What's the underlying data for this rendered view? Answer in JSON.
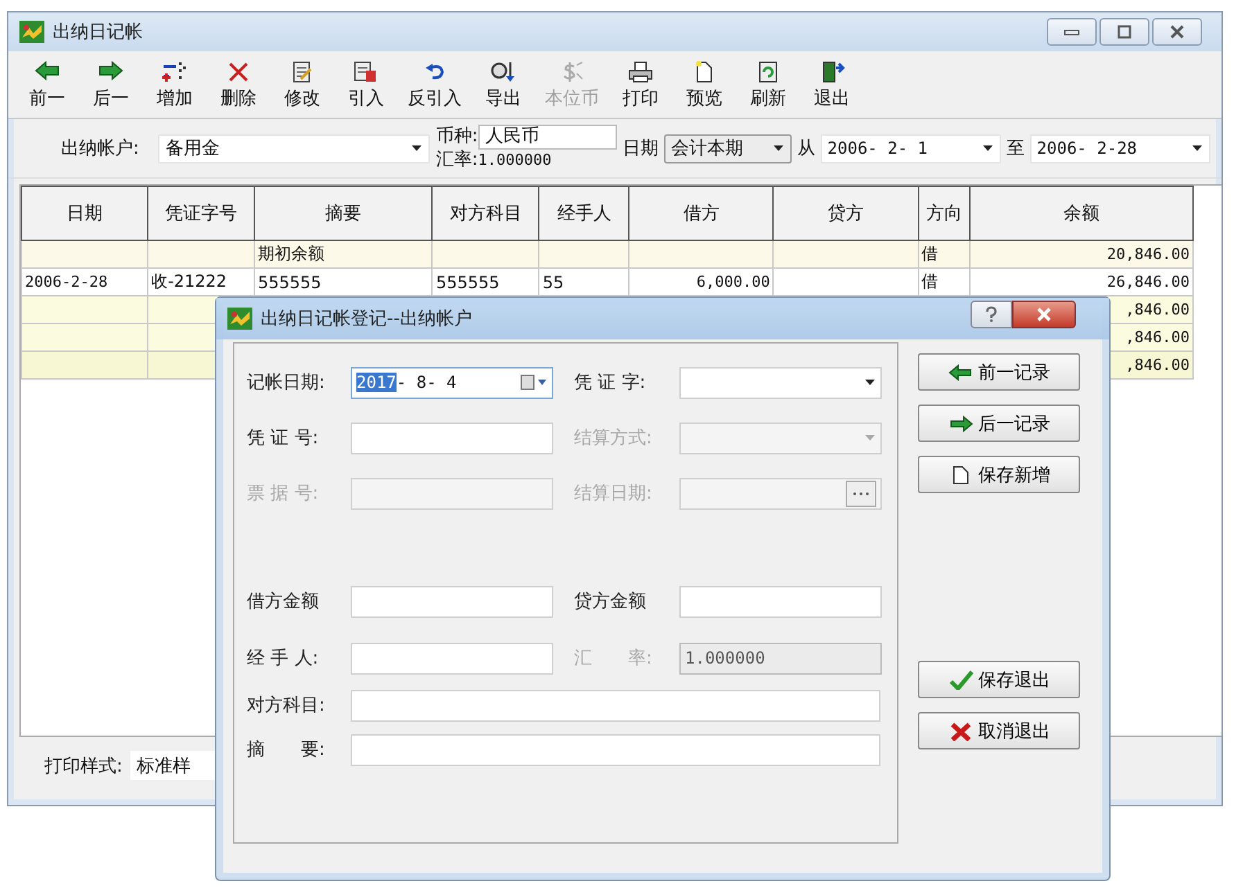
{
  "window": {
    "title": "出纳日记帐"
  },
  "toolbar": [
    {
      "label": "前一",
      "disabled": false
    },
    {
      "label": "后一",
      "disabled": false
    },
    {
      "label": "增加",
      "disabled": false
    },
    {
      "label": "删除",
      "disabled": false
    },
    {
      "label": "修改",
      "disabled": false
    },
    {
      "label": "引入",
      "disabled": false
    },
    {
      "label": "反引入",
      "disabled": false
    },
    {
      "label": "导出",
      "disabled": false
    },
    {
      "label": "本位币",
      "disabled": true
    },
    {
      "label": "打印",
      "disabled": false
    },
    {
      "label": "预览",
      "disabled": false
    },
    {
      "label": "刷新",
      "disabled": false
    },
    {
      "label": "退出",
      "disabled": false
    }
  ],
  "filter": {
    "account_label": "出纳帐户:",
    "account": "备用金",
    "currency_label": "币种:",
    "currency": "人民币",
    "rate_label": "汇率:",
    "rate": "1.000000",
    "date_label": "日期",
    "period": "会计本期",
    "from_label": "从",
    "from": "2006- 2- 1",
    "to_label": "至",
    "to": "2006- 2-28"
  },
  "table": {
    "columns": [
      "日期",
      "凭证字号",
      "摘要",
      "对方科目",
      "经手人",
      "借方",
      "贷方",
      "方向",
      "余额"
    ],
    "rows": [
      {
        "color": "#fdf9e8",
        "cells": [
          null,
          null,
          "期初余额",
          null,
          null,
          null,
          null,
          "借",
          "20,846.00"
        ]
      },
      {
        "color": "#ffffff",
        "cells": [
          "2006-2-28",
          "收-21222",
          "555555",
          "555555",
          "55",
          "6,000.00",
          null,
          "借",
          "26,846.00"
        ]
      },
      {
        "color": "#fbfbe0",
        "cells": [
          null,
          null,
          null,
          null,
          null,
          null,
          null,
          null,
          ",846.00"
        ]
      },
      {
        "color": "#fbfbe0",
        "cells": [
          null,
          null,
          null,
          null,
          null,
          null,
          null,
          null,
          ",846.00"
        ]
      },
      {
        "color": "#f7f7d4",
        "cells": [
          null,
          null,
          null,
          null,
          null,
          null,
          null,
          null,
          ",846.00"
        ]
      }
    ]
  },
  "footer": {
    "print_style_label": "打印样式:",
    "print_style": "标准样"
  },
  "dialog": {
    "title": "出纳日记帐登记--出纳帐户",
    "rows": [
      [
        {
          "kind": "date",
          "label": "记帐日期:",
          "selected_part": "2017",
          "value": "- 8- 4",
          "disabled": false
        },
        {
          "kind": "select",
          "label": "凭 证 字:",
          "disabled": false
        }
      ],
      [
        {
          "kind": "text",
          "label": "凭 证 号:",
          "disabled": false
        },
        {
          "kind": "select",
          "label": "结算方式:",
          "disabled": true
        }
      ],
      [
        {
          "kind": "text",
          "label": "票 据 号:",
          "disabled": true
        },
        {
          "kind": "browse",
          "label": "结算日期:",
          "disabled": true
        }
      ],
      [
        {
          "kind": "text",
          "label": "借方金额",
          "disabled": false
        },
        {
          "kind": "text",
          "label": "贷方金额",
          "disabled": false
        }
      ],
      [
        {
          "kind": "text",
          "label": "经 手 人:",
          "disabled": false
        },
        {
          "kind": "text",
          "label": "汇　　率:",
          "value": "1.000000",
          "disabled": true
        }
      ],
      [
        {
          "kind": "text",
          "label": "对方科目:",
          "disabled": false
        }
      ],
      [
        {
          "kind": "text",
          "label": "摘　　要:",
          "disabled": false
        }
      ]
    ],
    "buttons": [
      {
        "label": "前一记录",
        "kind": "prev"
      },
      {
        "label": "后一记录",
        "kind": "next"
      },
      {
        "label": "保存新增",
        "kind": "new"
      },
      {
        "label": "保存退出",
        "kind": "save"
      },
      {
        "label": "取消退出",
        "kind": "cancel"
      }
    ]
  }
}
